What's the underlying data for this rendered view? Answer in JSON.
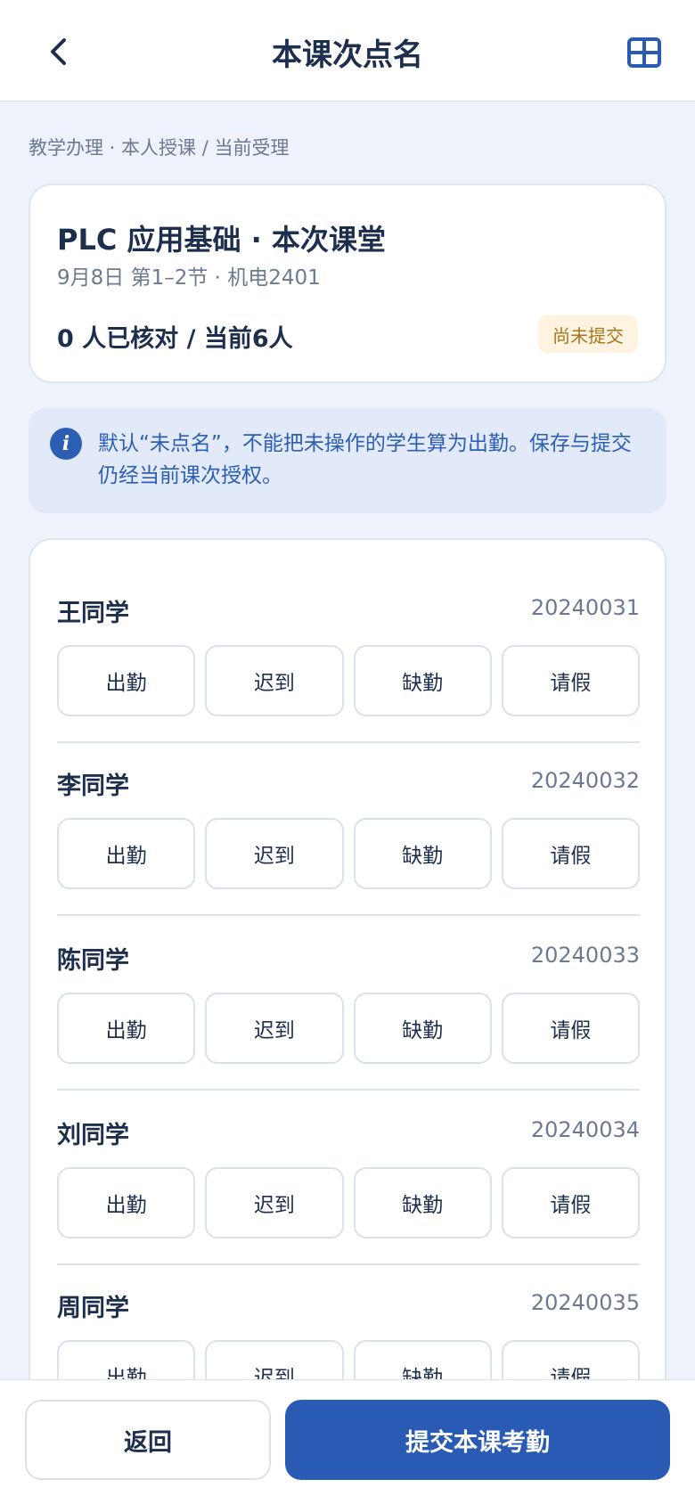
{
  "header": {
    "title": "本课次点名",
    "back_icon": "chevron-left-icon",
    "grid_icon": "grid-icon"
  },
  "breadcrumb": "教学办理 · 本人授课 / 当前受理",
  "course": {
    "title": "PLC 应用基础 · 本次课堂",
    "meta": "9月8日 第1–2节 · 机电2401",
    "count": "0 人已核对 / 当前6人",
    "status": "尚未提交"
  },
  "notice": {
    "icon": "info-icon",
    "text": "默认“未点名”，不能把未操作的学生算为出勤。保存与提交仍经当前课次授权。"
  },
  "options": [
    "出勤",
    "迟到",
    "缺勤",
    "请假"
  ],
  "students": [
    {
      "name": "王同学",
      "id": "20240031"
    },
    {
      "name": "李同学",
      "id": "20240032"
    },
    {
      "name": "陈同学",
      "id": "20240033"
    },
    {
      "name": "刘同学",
      "id": "20240034"
    },
    {
      "name": "周同学",
      "id": "20240035"
    }
  ],
  "footer": {
    "return_label": "返回",
    "submit_label": "提交本课考勤"
  },
  "colors": {
    "primary": "#2a5bb4",
    "text": "#1e2f4d",
    "muted": "#6c7a91",
    "badge_bg": "#fdf3e0",
    "badge_text": "#a9741e",
    "page_bg": "#eef3fb"
  }
}
